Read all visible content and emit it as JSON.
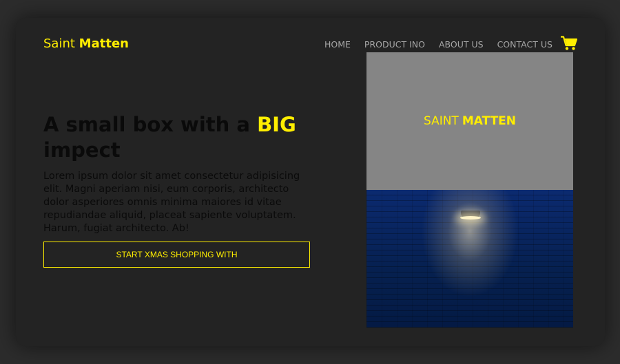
{
  "brand": {
    "prefix": "Saint",
    "bold": "Matten"
  },
  "nav": {
    "items": [
      {
        "label": "HOME"
      },
      {
        "label": "PRODUCT INO"
      },
      {
        "label": "ABOUT US"
      },
      {
        "label": "CONTACT US"
      }
    ],
    "cart_icon": "shopping-cart-icon"
  },
  "hero": {
    "title_part1": "A small box with a",
    "title_highlight": "BIG",
    "title_part2": "impect",
    "body": "Lorem ipsum dolor sit amet consectetur adipisicing elit. Magni aperiam nisi, eum corporis, architecto dolor asperiores omnis minima maiores id vitae repudiandae aliquid, placeat sapiente voluptatem. Harum, fugiat architecto. Ab!",
    "cta_label": "START XMAS SHOPPING WITH"
  },
  "visual": {
    "logo_prefix": "SAINT",
    "logo_bold": "MATTEN",
    "image": "lamp-on-blue-brick-wall"
  },
  "colors": {
    "accent": "#ffee00",
    "page_background": "#2c2c2c",
    "card_background": "#232323",
    "nav_text": "#a6a6a6",
    "visual_top": "#858585",
    "visual_bottom": "#0a2360"
  }
}
